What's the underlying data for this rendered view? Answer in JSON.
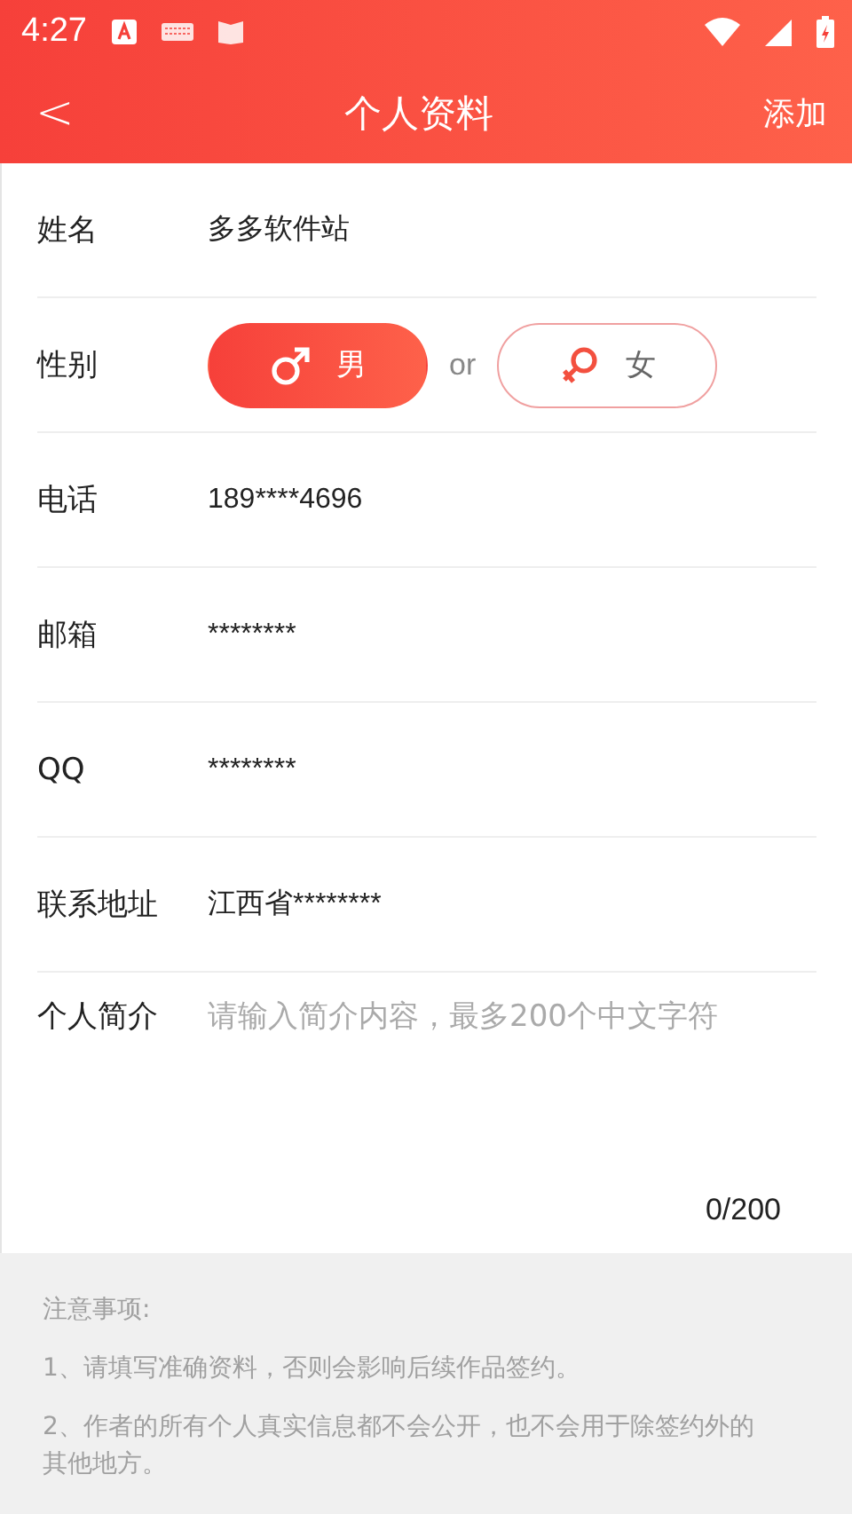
{
  "status_bar": {
    "time": "4:27"
  },
  "header": {
    "back": "<",
    "title": "个人资料",
    "action": "添加"
  },
  "fields": [
    {
      "kind": "text",
      "label": "姓名",
      "value": "多多软件站"
    },
    {
      "kind": "gender",
      "label": "性别",
      "separator": "or",
      "options": [
        {
          "label": "男",
          "kind": "male",
          "selected": true
        },
        {
          "label": "女",
          "kind": "female",
          "selected": false
        }
      ]
    },
    {
      "kind": "text",
      "label": "电话",
      "value": "189****4696"
    },
    {
      "kind": "text",
      "label": "邮箱",
      "value": "********"
    },
    {
      "kind": "text",
      "label": "QQ",
      "value": "********"
    },
    {
      "kind": "text",
      "label": "联系地址",
      "value": "江西省********"
    },
    {
      "kind": "textarea",
      "label": "个人简介",
      "placeholder": "请输入简介内容，最多200个中文字符",
      "counter": "0/200"
    }
  ],
  "notice": {
    "title": "注意事项:",
    "items": [
      "1、请填写准确资料，否则会影响后续作品签约。",
      "2、作者的所有个人真实信息都不会公开，也不会用于除签约外的其他地方。"
    ]
  }
}
